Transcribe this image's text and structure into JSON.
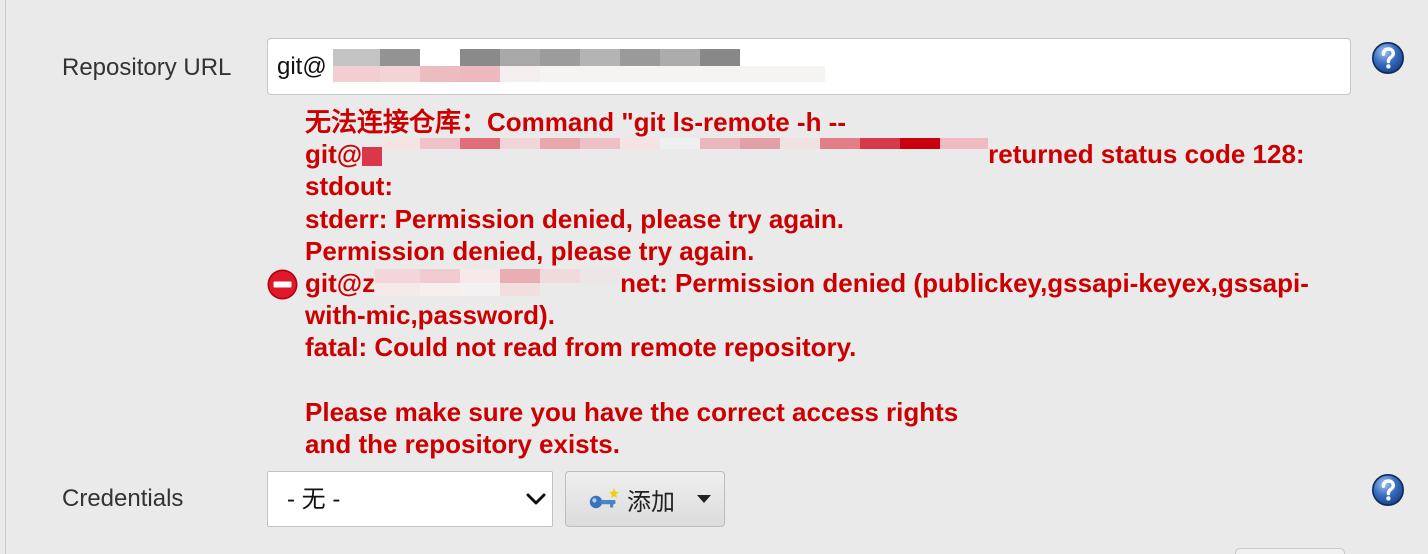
{
  "repository_url": {
    "label": "Repository URL",
    "value": "git@",
    "help_icon": "help-icon"
  },
  "error": {
    "icon": "error-stop-icon",
    "color": "#cc0000",
    "line_1": "无法连接仓库：Command \"git ls-remote -h --",
    "line_2": {
      "before": "git@",
      "after": "returned status code 128:"
    },
    "line_3": "stdout:",
    "line_4": "stderr: Permission denied, please try again.",
    "line_5": "Permission denied, please try again.",
    "line_6": {
      "before": "git@z",
      "after": "net: Permission denied (publickey,gssapi-keyex,gssapi-"
    },
    "line_7": "with-mic,password).",
    "line_8": "fatal: Could not read from remote repository.",
    "line_10": "Please make sure you have the correct access rights",
    "line_11": "and the repository exists."
  },
  "credentials": {
    "label": "Credentials",
    "selected": "- 无 -",
    "select_icon": "chevron-down-icon",
    "add_button": {
      "label": "添加",
      "icon": "key-icon",
      "dropdown_icon": "caret-down-icon"
    },
    "help_icon": "help-icon"
  }
}
